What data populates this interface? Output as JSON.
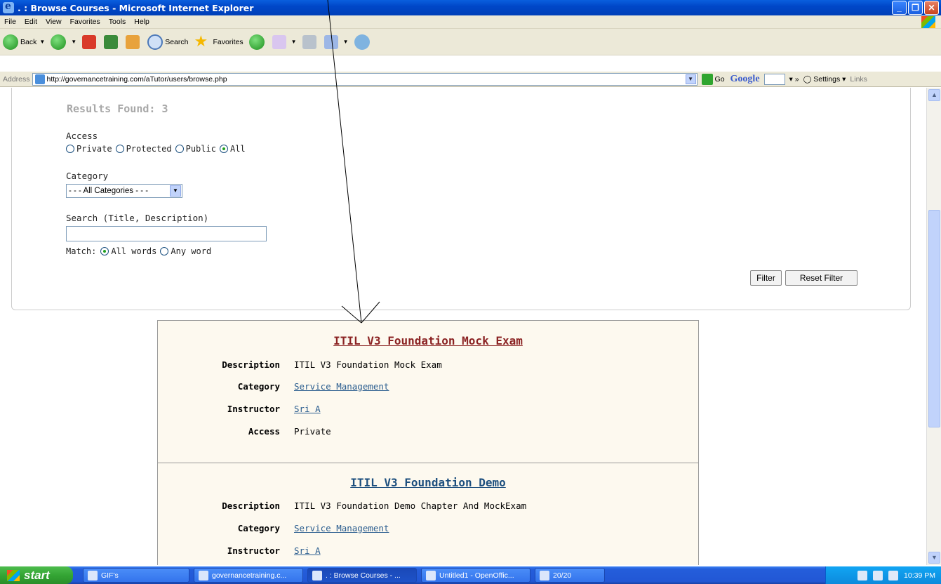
{
  "window": {
    "title": ". : Browse Courses - Microsoft Internet Explorer"
  },
  "menu": [
    "File",
    "Edit",
    "View",
    "Favorites",
    "Tools",
    "Help"
  ],
  "toolbar": {
    "back": "Back",
    "search": "Search",
    "favorites": "Favorites"
  },
  "address": {
    "label": "Address",
    "url": "http://governancetraining.com/aTutor/users/browse.php",
    "go": "Go"
  },
  "google_bar": {
    "logo": "Google",
    "settings": "Settings",
    "links": "Links"
  },
  "filter": {
    "results": "Results Found: 3",
    "access_label": "Access",
    "access_options": [
      "Private",
      "Protected",
      "Public",
      "All"
    ],
    "access_selected": "All",
    "category_label": "Category",
    "category_value": "- - - All Categories - - -",
    "search_label": "Search (Title, Description)",
    "search_value": "",
    "match_label": "Match:",
    "match_options": [
      "All words",
      "Any word"
    ],
    "match_selected": "All words",
    "filter_button": "Filter",
    "reset_button": "Reset Filter"
  },
  "courses": [
    {
      "title": "ITIL V3 Foundation Mock Exam",
      "title_color": "#8b2323",
      "labels": {
        "description": "Description",
        "category": "Category",
        "instructor": "Instructor",
        "access": "Access"
      },
      "description": "ITIL V3 Foundation Mock Exam",
      "category": "Service Management",
      "instructor": "Sri A",
      "access": "Private"
    },
    {
      "title": "ITIL V3 Foundation Demo",
      "title_color": "#1d4f7e",
      "labels": {
        "description": "Description",
        "category": "Category",
        "instructor": "Instructor"
      },
      "description": "ITIL V3 Foundation Demo Chapter And MockExam",
      "category": "Service Management",
      "instructor": "Sri A"
    }
  ],
  "taskbar": {
    "start": "start",
    "tasks": [
      "GIF's",
      "governancetraining.c...",
      ". : Browse Courses - ...",
      "Untitled1 - OpenOffic...",
      "20/20"
    ],
    "clock": "10:39 PM"
  }
}
